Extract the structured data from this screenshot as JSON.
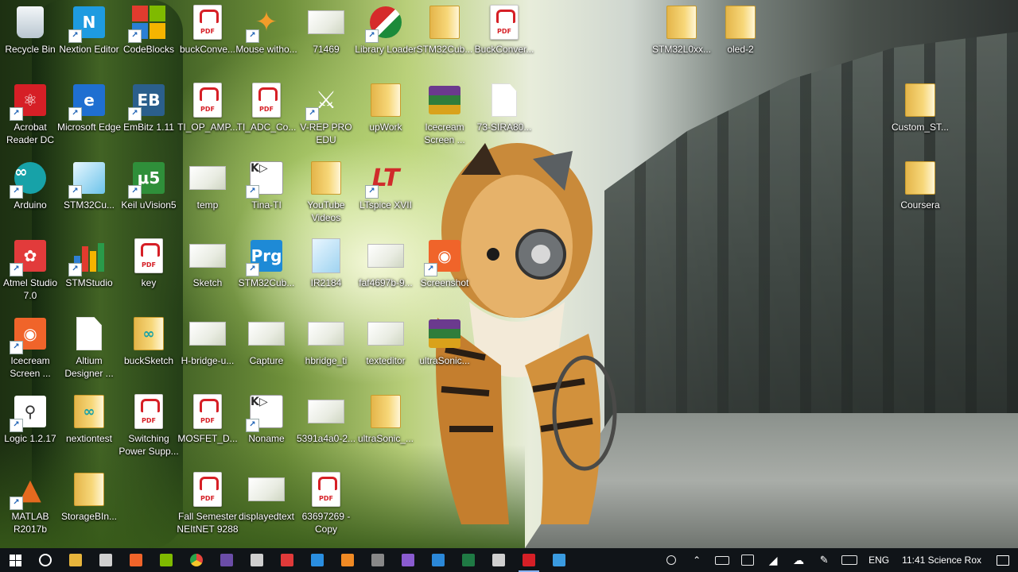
{
  "desktop": {
    "icons": [
      {
        "label": "Recycle Bin",
        "icon": "recycle-bin-icon"
      },
      {
        "label": "Nextion Editor",
        "icon": "nextion-editor-icon"
      },
      {
        "label": "CodeBlocks",
        "icon": "codeblocks-icon"
      },
      {
        "label": "buckConve...",
        "icon": "pdf-icon"
      },
      {
        "label": "Mouse witho...",
        "icon": "mouse-without-borders-icon"
      },
      {
        "label": "71469",
        "icon": "image-icon"
      },
      {
        "label": "Library Loader",
        "icon": "library-loader-icon"
      },
      {
        "label": "STM32Cub...",
        "icon": "folder-icon"
      },
      {
        "label": "BuckConver...",
        "icon": "pdf-icon"
      },
      {
        "label": "STM32L0xx...",
        "icon": "folder-icon"
      },
      {
        "label": "oled-2",
        "icon": "folder-icon"
      },
      {
        "label": "Acrobat Reader DC",
        "icon": "acrobat-reader-icon"
      },
      {
        "label": "Microsoft Edge",
        "icon": "edge-icon"
      },
      {
        "label": "EmBitz 1.11",
        "icon": "embitz-icon"
      },
      {
        "label": "TI_OP_AMP...",
        "icon": "pdf-icon"
      },
      {
        "label": "TI_ADC_Co...",
        "icon": "pdf-icon"
      },
      {
        "label": "V-REP PRO EDU",
        "icon": "vrep-icon"
      },
      {
        "label": "upWork",
        "icon": "folder-icon"
      },
      {
        "label": "Icecream Screen ...",
        "icon": "archive-icon"
      },
      {
        "label": "73-SIRA80...",
        "icon": "file-icon"
      },
      {
        "label": "Custom_ST...",
        "icon": "folder-icon"
      },
      {
        "label": "Arduino",
        "icon": "arduino-icon"
      },
      {
        "label": "STM32Cu...",
        "icon": "stm32cube-icon"
      },
      {
        "label": "Keil uVision5",
        "icon": "keil-icon"
      },
      {
        "label": "temp",
        "icon": "image-icon"
      },
      {
        "label": "Tina-TI",
        "icon": "tina-ti-icon"
      },
      {
        "label": "YouTube Videos",
        "icon": "folder-icon"
      },
      {
        "label": "LTspice XVII",
        "icon": "ltspice-icon"
      },
      {
        "label": "Coursera",
        "icon": "folder-icon"
      },
      {
        "label": "Atmel Studio 7.0",
        "icon": "atmel-studio-icon"
      },
      {
        "label": "STMStudio",
        "icon": "stmstudio-icon"
      },
      {
        "label": "key",
        "icon": "pdf-icon"
      },
      {
        "label": "Sketch",
        "icon": "image-icon"
      },
      {
        "label": "STM32Cub...",
        "icon": "stm32cubeprog-icon"
      },
      {
        "label": "IR2184",
        "icon": "document-icon"
      },
      {
        "label": "faf4697b-9...",
        "icon": "image-icon"
      },
      {
        "label": "Screenshot",
        "icon": "screenshot-icon"
      },
      {
        "label": "Icecream Screen ...",
        "icon": "icecream-icon"
      },
      {
        "label": "Altium Designer ...",
        "icon": "file-icon"
      },
      {
        "label": "buckSketch",
        "icon": "arduino-sketch-icon"
      },
      {
        "label": "H-bridge-u...",
        "icon": "image-icon"
      },
      {
        "label": "Capture",
        "icon": "image-icon"
      },
      {
        "label": "hbridge_ti",
        "icon": "image-icon"
      },
      {
        "label": "texteditor",
        "icon": "image-icon"
      },
      {
        "label": "ultraSonic...",
        "icon": "archive-icon"
      },
      {
        "label": "Logic 1.2.17",
        "icon": "logic-icon"
      },
      {
        "label": "nextiontest",
        "icon": "arduino-sketch-icon"
      },
      {
        "label": "Switching Power Supp...",
        "icon": "pdf-icon"
      },
      {
        "label": "MOSFET_D...",
        "icon": "pdf-icon"
      },
      {
        "label": "Noname",
        "icon": "tina-ti-icon"
      },
      {
        "label": "5391a4a0-2...",
        "icon": "image-icon"
      },
      {
        "label": "ultraSonic_...",
        "icon": "folder-icon"
      },
      {
        "label": "MATLAB R2017b",
        "icon": "matlab-icon"
      },
      {
        "label": "StorageBIn...",
        "icon": "folder-icon"
      },
      {
        "label": "Fall Semester NEItNET 9288",
        "icon": "pdf-icon"
      },
      {
        "label": "displayedtext",
        "icon": "image-icon"
      },
      {
        "label": "63697269 - Copy",
        "icon": "pdf-icon"
      }
    ]
  },
  "taskbar": {
    "buttons": [
      {
        "name": "start-button",
        "icon": "windows-icon",
        "color": "#ffffff"
      },
      {
        "name": "cortana-button",
        "icon": "cortana-circle-icon",
        "color": "#ffffff"
      },
      {
        "name": "file-explorer-button",
        "icon": "folder-icon",
        "color": "#e8b53c"
      },
      {
        "name": "calculator-button",
        "icon": "calculator-icon",
        "color": "#d0d0d0"
      },
      {
        "name": "app-orange-button",
        "icon": "screenshot-icon",
        "color": "#f0642a"
      },
      {
        "name": "codeblocks-taskbar-button",
        "icon": "codeblocks-icon",
        "color": "#7fba00"
      },
      {
        "name": "chrome-button",
        "icon": "chrome-icon",
        "color": "#e8453c"
      },
      {
        "name": "app-purple-button",
        "icon": "winrar-icon",
        "color": "#6b4da8"
      },
      {
        "name": "app-b-button",
        "icon": "embitz-icon",
        "color": "#cfcfcf"
      },
      {
        "name": "app-red-button",
        "icon": "atmel-icon",
        "color": "#e03a3a"
      },
      {
        "name": "vscode-button",
        "icon": "vscode-icon",
        "color": "#2a8ee0"
      },
      {
        "name": "matlab-taskbar-button",
        "icon": "matlab-icon",
        "color": "#f08a24"
      },
      {
        "name": "app-grey-button",
        "icon": "app-icon",
        "color": "#888888"
      },
      {
        "name": "visual-studio-button",
        "icon": "visual-studio-icon",
        "color": "#8a5cd0"
      },
      {
        "name": "defender-button",
        "icon": "shield-icon",
        "color": "#2b88d8"
      },
      {
        "name": "excel-button",
        "icon": "excel-icon",
        "color": "#1f7a44"
      },
      {
        "name": "app-pen-button",
        "icon": "pen-icon",
        "color": "#cfcfcf"
      },
      {
        "name": "acrobat-taskbar-button",
        "icon": "acrobat-icon",
        "color": "#d61f26",
        "active": true
      },
      {
        "name": "shield-app-button",
        "icon": "shield-icon",
        "color": "#3a9be0"
      }
    ],
    "tray": {
      "icons": [
        "people-icon",
        "chevron-up-icon",
        "battery-icon",
        "display-icon",
        "wifi-icon",
        "onedrive-icon",
        "pen-tray-icon",
        "keyboard-icon"
      ],
      "language": "ENG",
      "clock": "11:41 Science Rox"
    }
  }
}
